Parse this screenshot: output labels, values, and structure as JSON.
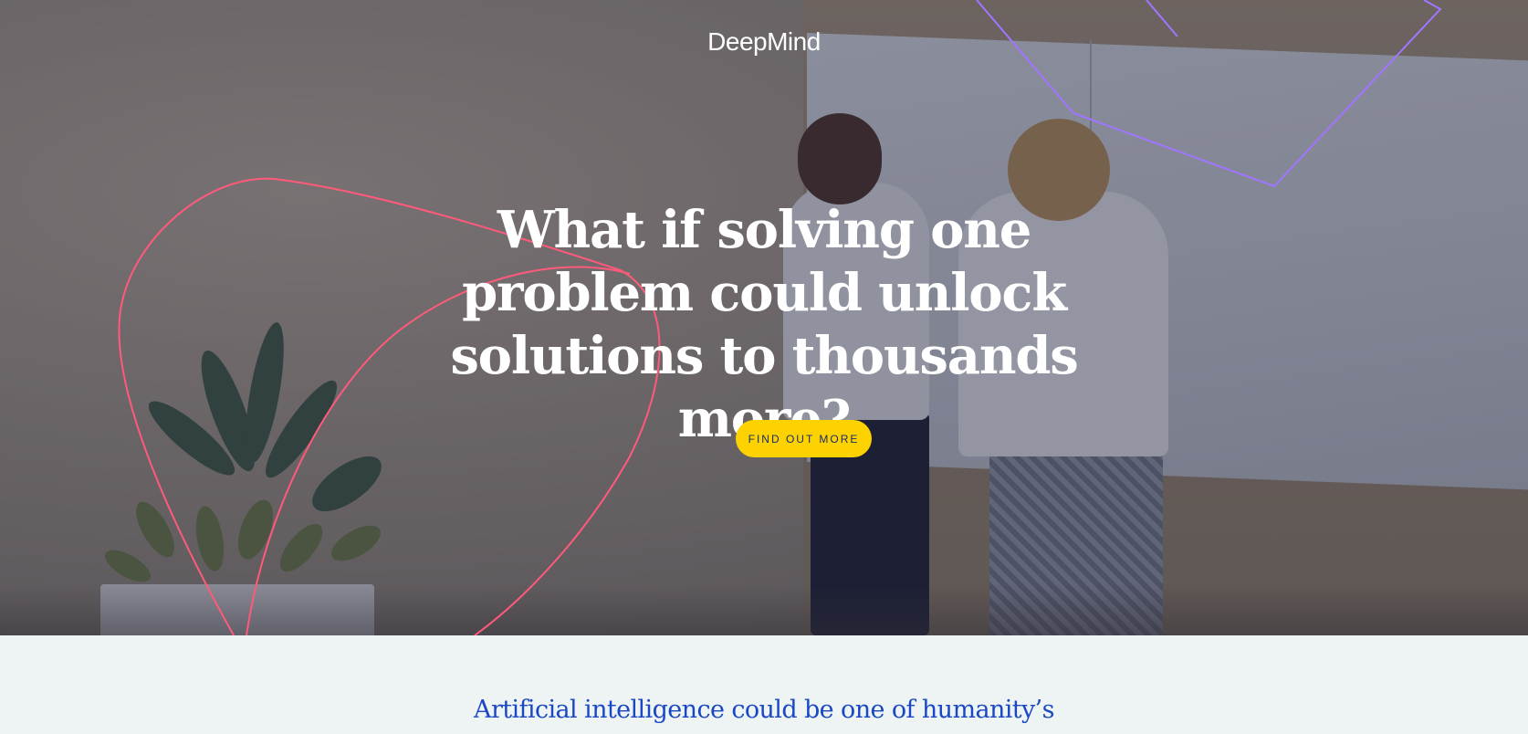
{
  "brand": {
    "logo_text": "DeepMind"
  },
  "hero": {
    "headline": "What if solving one problem could unlock solutions to thousands more?",
    "cta_label": "FIND OUT MORE"
  },
  "intro": {
    "text": "Artificial intelligence could be one of humanity’s"
  },
  "colors": {
    "cta_background": "#fcd200",
    "cta_text": "#1a2c6b",
    "intro_text": "#1a48c4",
    "intro_background": "#eef3f3",
    "accent_line_pink": "#ff5a7a",
    "accent_line_purple": "#a175ff"
  }
}
